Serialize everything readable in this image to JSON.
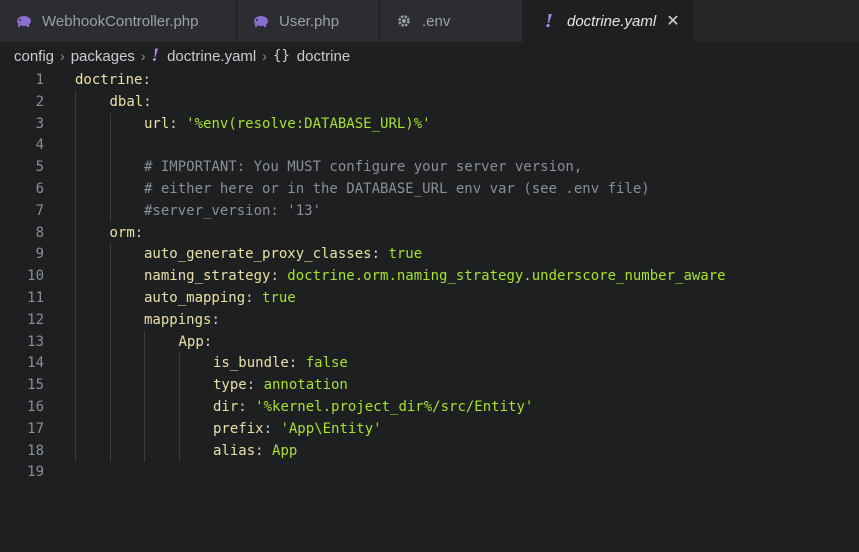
{
  "tabs": [
    {
      "label": "WebhookController.php",
      "icon": "php-elephant-icon",
      "active": false
    },
    {
      "label": "User.php",
      "icon": "php-elephant-icon",
      "active": false
    },
    {
      "label": ".env",
      "icon": "gear-icon",
      "active": false
    },
    {
      "label": "doctrine.yaml",
      "icon": "yaml-exclamation-icon",
      "active": true,
      "close": "✕"
    }
  ],
  "breadcrumb": {
    "items": [
      "config",
      "packages",
      "doctrine.yaml",
      "doctrine"
    ],
    "separator": "›",
    "file_icon": "!",
    "object_icon": "{}"
  },
  "editor": {
    "lines": [
      {
        "n": "1",
        "indent": 0,
        "key": "doctrine",
        "colon": ":",
        "value": "",
        "vtype": ""
      },
      {
        "n": "2",
        "indent": 1,
        "key": "dbal",
        "colon": ":",
        "value": "",
        "vtype": ""
      },
      {
        "n": "3",
        "indent": 2,
        "key": "url",
        "colon": ": ",
        "value": "'%env(resolve:DATABASE_URL)%'",
        "vtype": "s"
      },
      {
        "n": "4",
        "indent": 2,
        "key": "",
        "colon": "",
        "value": "",
        "vtype": ""
      },
      {
        "n": "5",
        "indent": 2,
        "key": "",
        "colon": "",
        "value": "# IMPORTANT: You MUST configure your server version,",
        "vtype": "c"
      },
      {
        "n": "6",
        "indent": 2,
        "key": "",
        "colon": "",
        "value": "# either here or in the DATABASE_URL env var (see .env file)",
        "vtype": "c"
      },
      {
        "n": "7",
        "indent": 2,
        "key": "",
        "colon": "",
        "value": "#server_version: '13'",
        "vtype": "c"
      },
      {
        "n": "8",
        "indent": 1,
        "key": "orm",
        "colon": ":",
        "value": "",
        "vtype": ""
      },
      {
        "n": "9",
        "indent": 2,
        "key": "auto_generate_proxy_classes",
        "colon": ": ",
        "value": "true",
        "vtype": "v"
      },
      {
        "n": "10",
        "indent": 2,
        "key": "naming_strategy",
        "colon": ": ",
        "value": "doctrine.orm.naming_strategy.underscore_number_aware",
        "vtype": "v"
      },
      {
        "n": "11",
        "indent": 2,
        "key": "auto_mapping",
        "colon": ": ",
        "value": "true",
        "vtype": "v"
      },
      {
        "n": "12",
        "indent": 2,
        "key": "mappings",
        "colon": ":",
        "value": "",
        "vtype": ""
      },
      {
        "n": "13",
        "indent": 3,
        "key": "App",
        "colon": ":",
        "value": "",
        "vtype": ""
      },
      {
        "n": "14",
        "indent": 4,
        "key": "is_bundle",
        "colon": ": ",
        "value": "false",
        "vtype": "v"
      },
      {
        "n": "15",
        "indent": 4,
        "key": "type",
        "colon": ": ",
        "value": "annotation",
        "vtype": "v"
      },
      {
        "n": "16",
        "indent": 4,
        "key": "dir",
        "colon": ": ",
        "value": "'%kernel.project_dir%/src/Entity'",
        "vtype": "s"
      },
      {
        "n": "17",
        "indent": 4,
        "key": "prefix",
        "colon": ": ",
        "value": "'App\\Entity'",
        "vtype": "s"
      },
      {
        "n": "18",
        "indent": 4,
        "key": "alias",
        "colon": ": ",
        "value": "App",
        "vtype": "v"
      },
      {
        "n": "19",
        "indent": 0,
        "key": "",
        "colon": "",
        "value": "",
        "vtype": ""
      }
    ]
  },
  "colors": {
    "background": "#1e1f21",
    "key": "#e8e1a7",
    "string": "#a6e22e",
    "comment": "#8a8f96",
    "yaml_icon": "#b084e8"
  }
}
